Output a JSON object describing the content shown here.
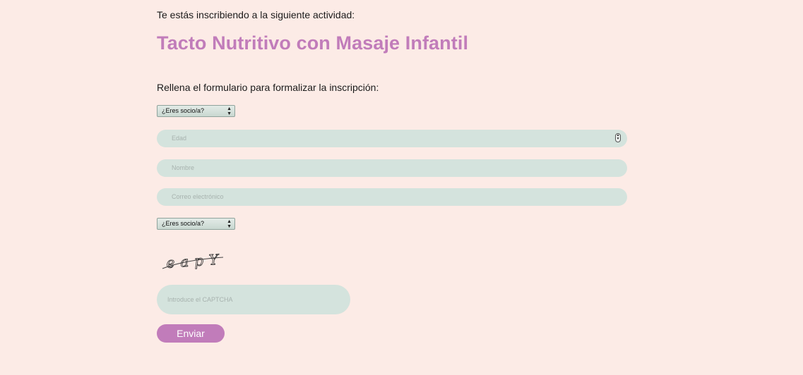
{
  "header": {
    "intro": "Te estás inscribiendo a la siguiente actividad:",
    "activity_title": "Tacto Nutritivo con Masaje Infantil"
  },
  "form": {
    "intro": "Rellena el formulario para formalizar la inscripción:",
    "select_socio_1": "¿Eres socio/a?",
    "age_placeholder": "Edad",
    "name_placeholder": "Nombre",
    "email_placeholder": "Correo electrónico",
    "select_socio_2": "¿Eres socio/a?",
    "captcha_placeholder": "Introduce el CAPTCHA",
    "submit_label": "Enviar"
  },
  "captcha": {
    "text": "eapY"
  },
  "colors": {
    "background": "#fcebe6",
    "accent": "#c17cba",
    "field": "#d4e3dd"
  }
}
